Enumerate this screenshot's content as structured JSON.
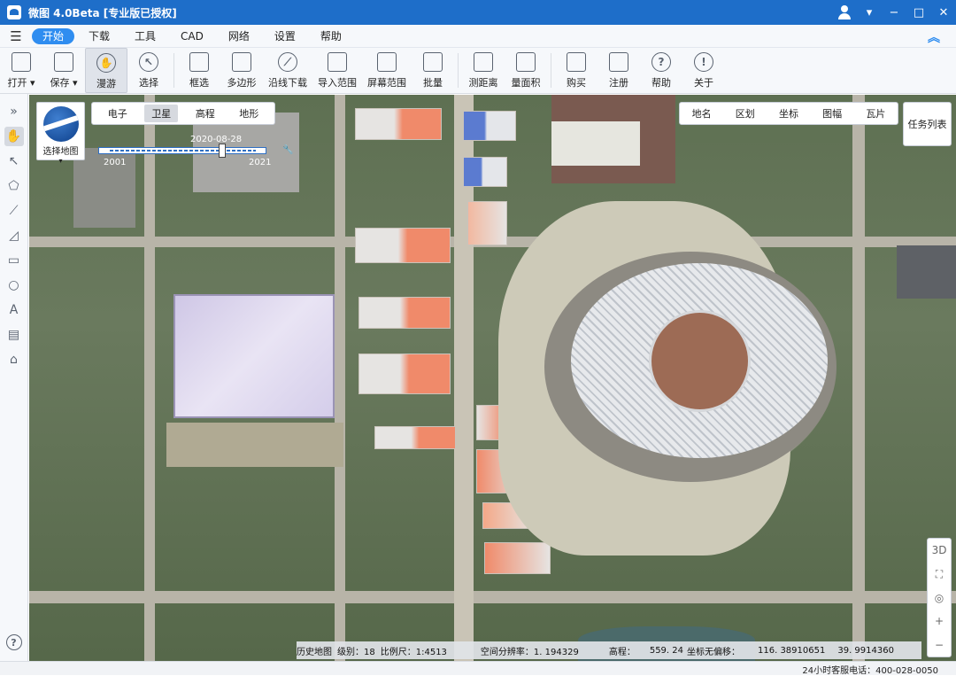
{
  "window": {
    "title": "微图 4.0Beta [专业版已授权]"
  },
  "menu": {
    "items": [
      {
        "label": "开始",
        "active": true
      },
      {
        "label": "下载"
      },
      {
        "label": "工具"
      },
      {
        "label": "CAD"
      },
      {
        "label": "网络"
      },
      {
        "label": "设置"
      },
      {
        "label": "帮助"
      }
    ]
  },
  "toolbar": {
    "open": "打开",
    "save": "保存",
    "roam": "漫游",
    "select": "选择",
    "box_select": "框选",
    "polygon": "多边形",
    "line_download": "沿线下载",
    "import_range": "导入范围",
    "screen_range": "屏幕范围",
    "batch": "批量",
    "measure_distance": "测距离",
    "measure_area": "量面积",
    "buy": "购买",
    "register": "注册",
    "help": "帮助",
    "about": "关于"
  },
  "map": {
    "switcher_label": "选择地图",
    "type_tabs": [
      "电子",
      "卫星",
      "高程",
      "地形"
    ],
    "active_type": "卫星",
    "timeline": {
      "date": "2020-08-28",
      "start_year": "2001",
      "end_year": "2021"
    },
    "layer_tabs": [
      "地名",
      "区划",
      "坐标",
      "图幅",
      "瓦片"
    ],
    "task_list": "任务列表",
    "nav": {
      "mode_3d": "3D",
      "zoom_in": "+",
      "zoom_out": "−"
    }
  },
  "status": {
    "history": "历史地图",
    "level": "级别：18",
    "scale": "比例尺：1:4513",
    "resolution": "空间分辨率：1. 194329",
    "elevation_label": "高程：",
    "elevation": "559. 24",
    "coord_label": "坐标无偏移：",
    "lon": "116. 38910651",
    "lat": "39. 9914360"
  },
  "footer": {
    "hotline": "24小时客服电话：400-028-0050"
  }
}
